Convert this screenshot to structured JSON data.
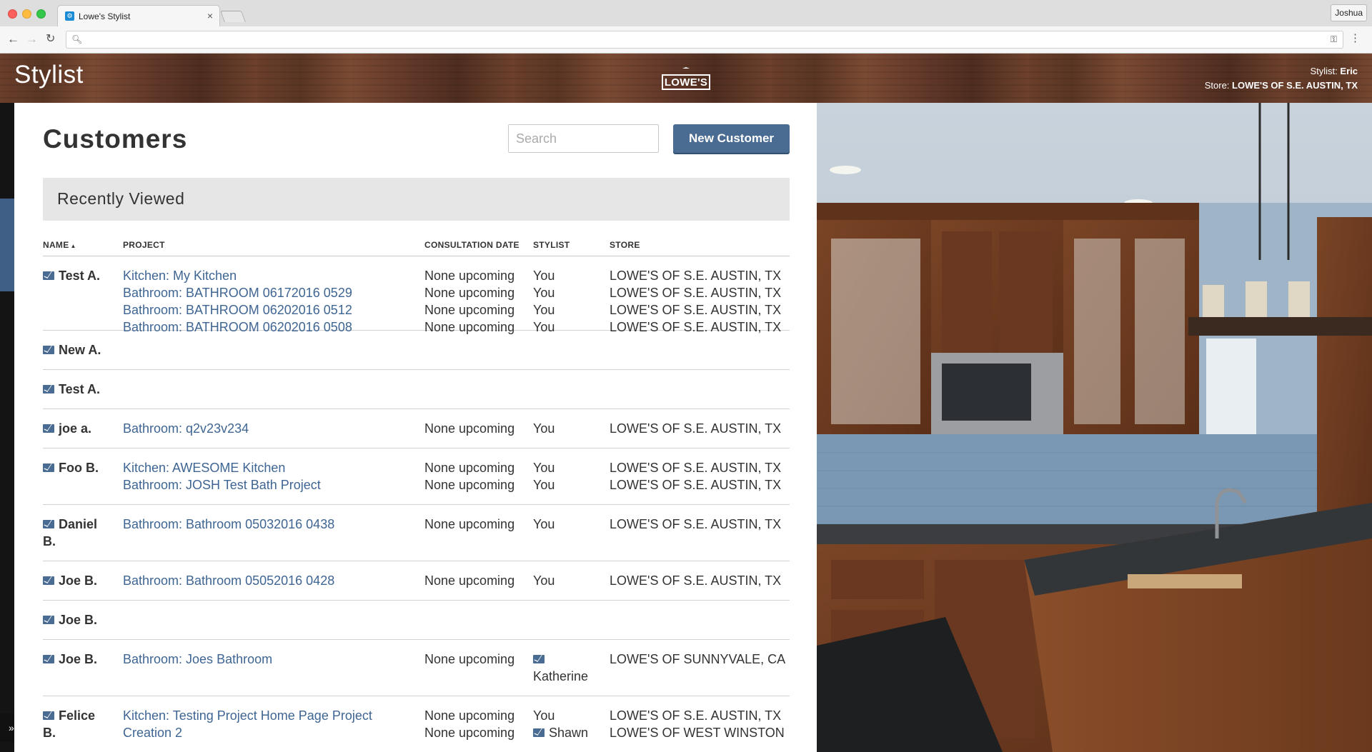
{
  "browser": {
    "tab_title": "Lowe's Stylist",
    "profile": "Joshua",
    "address": ""
  },
  "header": {
    "app_title": "Stylist",
    "logo_text": "LOWE'S",
    "stylist_label": "Stylist:",
    "stylist_name": "Eric",
    "store_label": "Store:",
    "store_name": "LOWE'S OF S.E. AUSTIN, TX"
  },
  "main": {
    "title": "Customers",
    "search_placeholder": "Search",
    "new_customer_label": "New Customer",
    "section_title": "Recently Viewed"
  },
  "table": {
    "columns": {
      "name": "NAME",
      "project": "PROJECT",
      "date": "CONSULTATION DATE",
      "stylist": "STYLIST",
      "store": "STORE"
    },
    "rows": [
      {
        "name": "Test A.",
        "projects": [
          {
            "project": "Kitchen: My Kitchen",
            "date": "None upcoming",
            "stylist": "You",
            "store": "LOWE'S OF S.E. AUSTIN, TX"
          },
          {
            "project": "Bathroom: BATHROOM 06172016 0529",
            "date": "None upcoming",
            "stylist": "You",
            "store": "LOWE'S OF S.E. AUSTIN, TX"
          },
          {
            "project": "Bathroom: BATHROOM 06202016 0512",
            "date": "None upcoming",
            "stylist": "You",
            "store": "LOWE'S OF S.E. AUSTIN, TX"
          },
          {
            "project": "Bathroom: BATHROOM 06202016 0508",
            "date": "None upcoming",
            "stylist": "You",
            "store": "LOWE'S OF S.E. AUSTIN, TX"
          }
        ]
      },
      {
        "name": "New A.",
        "projects": []
      },
      {
        "name": "Test A.",
        "projects": []
      },
      {
        "name": "joe a.",
        "projects": [
          {
            "project": "Bathroom: q2v23v234",
            "date": "None upcoming",
            "stylist": "You",
            "store": "LOWE'S OF S.E. AUSTIN, TX"
          }
        ]
      },
      {
        "name": "Foo B.",
        "projects": [
          {
            "project": "Kitchen: AWESOME Kitchen",
            "date": "None upcoming",
            "stylist": "You",
            "store": "LOWE'S OF S.E. AUSTIN, TX"
          },
          {
            "project": "Bathroom: JOSH Test Bath Project",
            "date": "None upcoming",
            "stylist": "You",
            "store": "LOWE'S OF S.E. AUSTIN, TX"
          }
        ]
      },
      {
        "name_line1": "Daniel",
        "name_line2": "B.",
        "projects": [
          {
            "project": "Bathroom: Bathroom 05032016 0438",
            "date": "None upcoming",
            "stylist": "You",
            "store": "LOWE'S OF S.E. AUSTIN, TX"
          }
        ]
      },
      {
        "name": "Joe B.",
        "projects": [
          {
            "project": "Bathroom: Bathroom 05052016 0428",
            "date": "None upcoming",
            "stylist": "You",
            "store": "LOWE'S OF S.E. AUSTIN, TX"
          }
        ]
      },
      {
        "name": "Joe B.",
        "projects": []
      },
      {
        "name": "Joe B.",
        "projects": [
          {
            "project": "Bathroom: Joes Bathroom",
            "date": "None upcoming",
            "stylist": "Katherine",
            "store": "LOWE'S OF SUNNYVALE, CA"
          }
        ]
      },
      {
        "name_line1": "Felice",
        "name_line2": "B.",
        "projects": [
          {
            "project": "Kitchen: Testing Project Home Page Project",
            "project_cont": "Creation 2",
            "date": "None upcoming",
            "stylist": "You",
            "store": "LOWE'S OF S.E. AUSTIN, TX"
          },
          {
            "project": "",
            "date": "None upcoming",
            "stylist": "Shawn",
            "store": "LOWE'S OF WEST WINSTON"
          }
        ]
      }
    ]
  },
  "colors": {
    "accent": "#4a6b92",
    "link": "#3f6593",
    "header_wood": "#5a3524"
  }
}
